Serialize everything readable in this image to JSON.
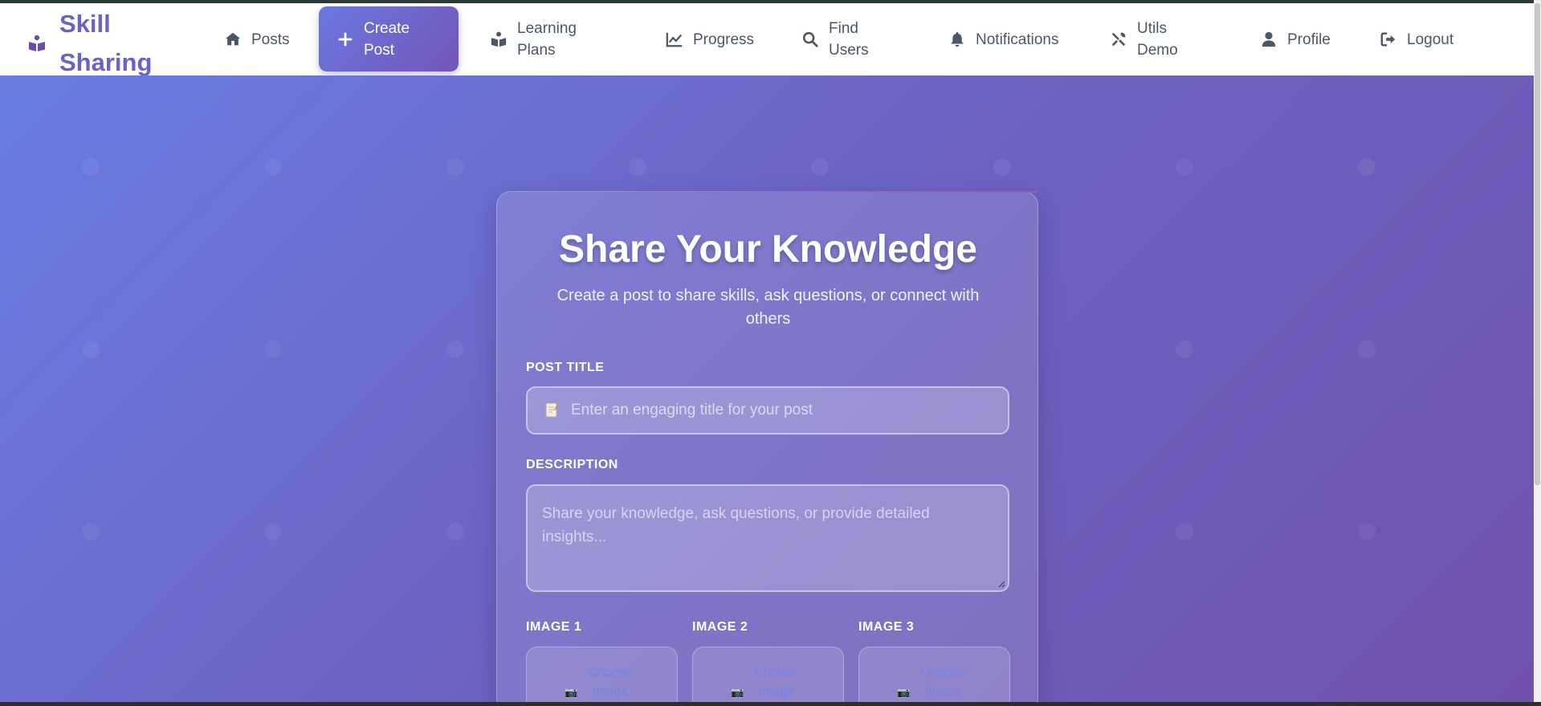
{
  "brand": {
    "name": "Skill Sharing",
    "icon": "book-reader-icon"
  },
  "nav": {
    "items": [
      {
        "label": "Posts",
        "icon": "home-icon"
      },
      {
        "label": "Create Post",
        "icon": "plus-icon",
        "active": true
      },
      {
        "label": "Learning Plans",
        "icon": "book-reader-icon"
      },
      {
        "label": "Progress",
        "icon": "chart-line-icon"
      },
      {
        "label": "Find Users",
        "icon": "search-icon"
      },
      {
        "label": "Notifications",
        "icon": "bell-icon"
      },
      {
        "label": "Utils Demo",
        "icon": "tools-icon"
      },
      {
        "label": "Profile",
        "icon": "user-icon"
      },
      {
        "label": "Logout",
        "icon": "logout-icon"
      }
    ]
  },
  "form": {
    "title": "Share Your Knowledge",
    "subtitle": "Create a post to share skills, ask questions, or connect with others",
    "post_title_label": "POST TITLE",
    "post_title_placeholder": "Enter an engaging title for your post",
    "description_label": "DESCRIPTION",
    "description_placeholder": "Share your knowledge, ask questions, or provide detailed insights...",
    "images": [
      {
        "label": "IMAGE 1",
        "button": "Choose Image"
      },
      {
        "label": "IMAGE 2",
        "button": "Choose Image"
      },
      {
        "label": "IMAGE 3",
        "button": "Choose Image"
      }
    ]
  },
  "colors": {
    "brand": "#6b62c9",
    "nav_text": "#4b5666",
    "active_gradient_start": "#6a78e0",
    "active_gradient_end": "#7355b8",
    "link": "#6f85ea"
  }
}
